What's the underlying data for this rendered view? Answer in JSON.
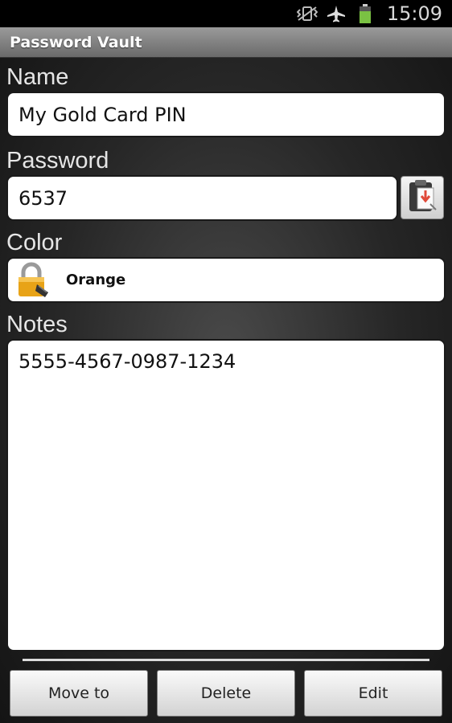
{
  "status_bar": {
    "time": "15:09",
    "icons": [
      "vibrate-icon",
      "airplane-icon",
      "battery-icon"
    ],
    "battery_color": "#7ac143"
  },
  "app": {
    "title": "Password Vault"
  },
  "form": {
    "name_label": "Name",
    "name_value": "My Gold Card PIN",
    "password_label": "Password",
    "password_value": "6537",
    "color_label": "Color",
    "color_value": "Orange",
    "notes_label": "Notes",
    "notes_value": "5555-4567-0987-1234"
  },
  "buttons": {
    "move_to": "Move to",
    "delete": "Delete",
    "edit": "Edit"
  },
  "colors": {
    "lock_orange": "#e8a317",
    "clipboard_arrow": "#e04a3a"
  }
}
